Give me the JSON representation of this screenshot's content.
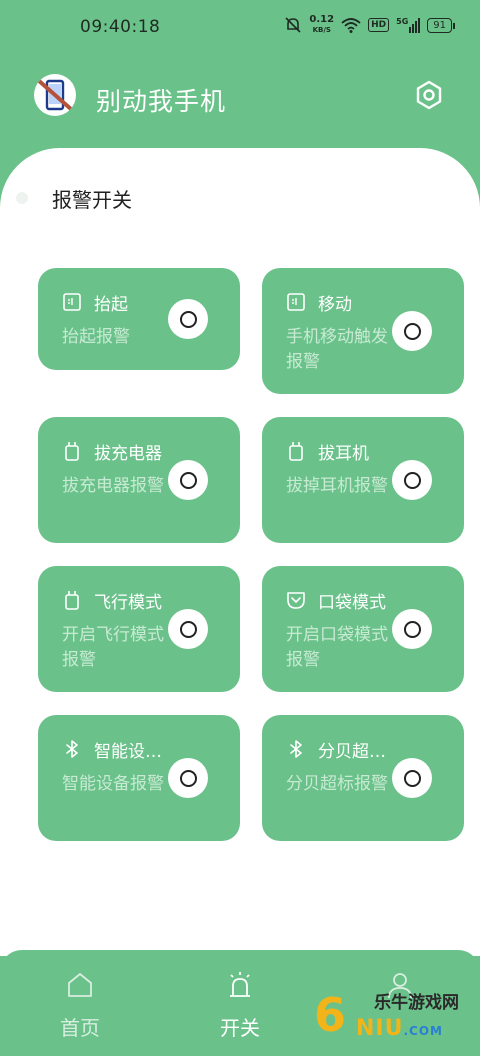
{
  "status_bar": {
    "time": "09:40:18",
    "net_speed_value": "0.12",
    "net_speed_unit": "KB/S",
    "hd_label": "HD",
    "signal_label": "5G",
    "battery": "91"
  },
  "header": {
    "title": "别动我手机",
    "logo_icon": "phone-crossed-icon",
    "settings_icon": "gear-icon"
  },
  "section": {
    "title": "报警开关"
  },
  "tiles": [
    {
      "title": "抬起",
      "desc": "抬起报警",
      "icon": "phone-frame-icon"
    },
    {
      "title": "移动",
      "desc": "手机移动触发报警",
      "icon": "phone-frame-icon"
    },
    {
      "title": "拔充电器",
      "desc": "拔充电器报警",
      "icon": "charger-plug-icon"
    },
    {
      "title": "拔耳机",
      "desc": "拔掉耳机报警",
      "icon": "charger-plug-icon"
    },
    {
      "title": "飞行模式",
      "desc": "开启飞行模式报警",
      "icon": "charger-plug-icon"
    },
    {
      "title": "口袋模式",
      "desc": "开启口袋模式报警",
      "icon": "pocket-icon"
    },
    {
      "title": "智能设…",
      "desc": "智能设备报警",
      "icon": "bluetooth-icon"
    },
    {
      "title": "分贝超…",
      "desc": "分贝超标报警",
      "icon": "bluetooth-icon"
    }
  ],
  "bottom_nav": {
    "home_label": "首页",
    "switch_label": "开关"
  },
  "watermark": {
    "digit": "6",
    "brand": "乐牛游戏网",
    "sub": "NIU",
    "sub_suffix": ".COM"
  },
  "colors": {
    "primary": "#6ac28a",
    "card": "#ffffff",
    "muted_text": "#c7ead3"
  }
}
